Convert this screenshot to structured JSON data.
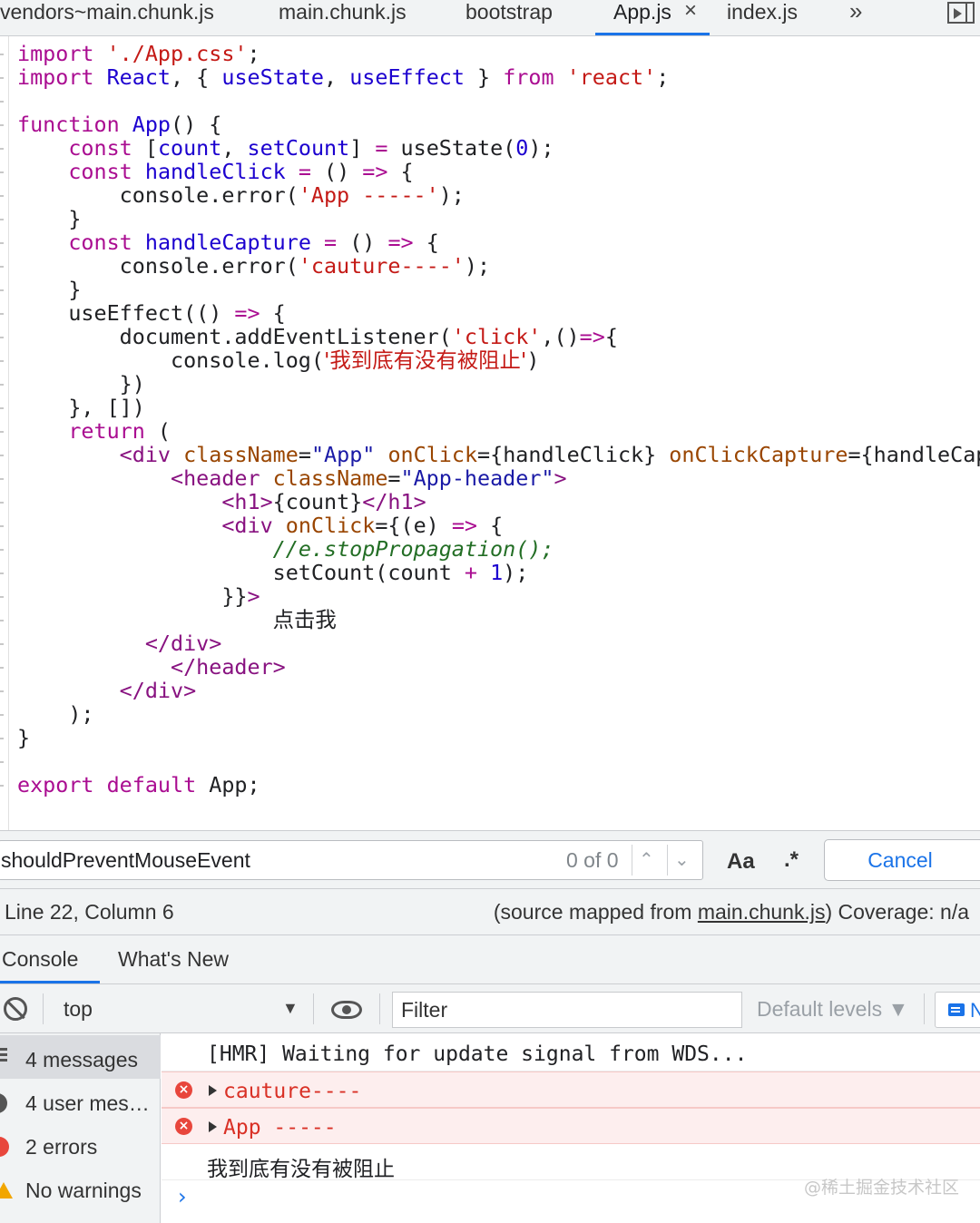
{
  "tabs": [
    {
      "label": "vendors~main.chunk.js",
      "active": false
    },
    {
      "label": "main.chunk.js",
      "active": false
    },
    {
      "label": "bootstrap",
      "active": false
    },
    {
      "label": "App.js",
      "active": true,
      "closable": true
    },
    {
      "label": "index.js",
      "active": false
    }
  ],
  "tab_overflow_symbol": "»",
  "tab_close_symbol": "×",
  "code": {
    "language": "javascript",
    "lines": [
      [
        {
          "t": "import",
          "c": "kw"
        },
        {
          "t": " "
        },
        {
          "t": "'./App.css'",
          "c": "str"
        },
        {
          "t": ";"
        }
      ],
      [
        {
          "t": "import",
          "c": "kw"
        },
        {
          "t": " "
        },
        {
          "t": "React",
          "c": "id"
        },
        {
          "t": ", { "
        },
        {
          "t": "useState",
          "c": "id"
        },
        {
          "t": ", "
        },
        {
          "t": "useEffect",
          "c": "id"
        },
        {
          "t": " } "
        },
        {
          "t": "from",
          "c": "kw"
        },
        {
          "t": " "
        },
        {
          "t": "'react'",
          "c": "str"
        },
        {
          "t": ";"
        }
      ],
      [],
      [
        {
          "t": "function",
          "c": "kw"
        },
        {
          "t": " "
        },
        {
          "t": "App",
          "c": "fn"
        },
        {
          "t": "() {"
        }
      ],
      [
        {
          "t": "    "
        },
        {
          "t": "const",
          "c": "kw"
        },
        {
          "t": " ["
        },
        {
          "t": "count",
          "c": "id"
        },
        {
          "t": ", "
        },
        {
          "t": "setCount",
          "c": "id"
        },
        {
          "t": "] "
        },
        {
          "t": "=",
          "c": "op"
        },
        {
          "t": " useState("
        },
        {
          "t": "0",
          "c": "num"
        },
        {
          "t": ");"
        }
      ],
      [
        {
          "t": "    "
        },
        {
          "t": "const",
          "c": "kw"
        },
        {
          "t": " "
        },
        {
          "t": "handleClick",
          "c": "id"
        },
        {
          "t": " "
        },
        {
          "t": "=",
          "c": "op"
        },
        {
          "t": " () "
        },
        {
          "t": "=>",
          "c": "op"
        },
        {
          "t": " {"
        }
      ],
      [
        {
          "t": "        console.error("
        },
        {
          "t": "'App -----'",
          "c": "str"
        },
        {
          "t": ");"
        }
      ],
      [
        {
          "t": "    }"
        }
      ],
      [
        {
          "t": "    "
        },
        {
          "t": "const",
          "c": "kw"
        },
        {
          "t": " "
        },
        {
          "t": "handleCapture",
          "c": "id"
        },
        {
          "t": " "
        },
        {
          "t": "=",
          "c": "op"
        },
        {
          "t": " () "
        },
        {
          "t": "=>",
          "c": "op"
        },
        {
          "t": " {"
        }
      ],
      [
        {
          "t": "        console.error("
        },
        {
          "t": "'cauture----'",
          "c": "str"
        },
        {
          "t": ");"
        }
      ],
      [
        {
          "t": "    }"
        }
      ],
      [
        {
          "t": "    useEffect(() "
        },
        {
          "t": "=>",
          "c": "op"
        },
        {
          "t": " {"
        }
      ],
      [
        {
          "t": "        document.addEventListener("
        },
        {
          "t": "'click'",
          "c": "str"
        },
        {
          "t": ",()"
        },
        {
          "t": "=>",
          "c": "op"
        },
        {
          "t": "{"
        }
      ],
      [
        {
          "t": "            console.log("
        },
        {
          "t": "'我到底有没有被阻止'",
          "c": "str cjk"
        },
        {
          "t": ")"
        }
      ],
      [
        {
          "t": "        })"
        }
      ],
      [
        {
          "t": "    }, [])"
        }
      ],
      [
        {
          "t": "    "
        },
        {
          "t": "return",
          "c": "kw"
        },
        {
          "t": " ("
        }
      ],
      [
        {
          "t": "        "
        },
        {
          "t": "<div",
          "c": "tagc"
        },
        {
          "t": " "
        },
        {
          "t": "className",
          "c": "attr"
        },
        {
          "t": "="
        },
        {
          "t": "\"App\"",
          "c": "aval"
        },
        {
          "t": " "
        },
        {
          "t": "onClick",
          "c": "attr"
        },
        {
          "t": "={handleClick} "
        },
        {
          "t": "onClickCapture",
          "c": "attr"
        },
        {
          "t": "={handleCapture}>"
        }
      ],
      [
        {
          "t": "            "
        },
        {
          "t": "<header",
          "c": "tagc"
        },
        {
          "t": " "
        },
        {
          "t": "className",
          "c": "attr"
        },
        {
          "t": "="
        },
        {
          "t": "\"App-header\"",
          "c": "aval"
        },
        {
          "t": ">",
          "c": "tagc"
        }
      ],
      [
        {
          "t": "                "
        },
        {
          "t": "<h1>",
          "c": "tagc"
        },
        {
          "t": "{count}"
        },
        {
          "t": "</h1>",
          "c": "tagc"
        }
      ],
      [
        {
          "t": "                "
        },
        {
          "t": "<div",
          "c": "tagc"
        },
        {
          "t": " "
        },
        {
          "t": "onClick",
          "c": "attr"
        },
        {
          "t": "={(e) "
        },
        {
          "t": "=>",
          "c": "op"
        },
        {
          "t": " {"
        }
      ],
      [
        {
          "t": "                    "
        },
        {
          "t": "//e.stopPropagation();",
          "c": "cmt"
        }
      ],
      [
        {
          "t": "                    setCount(count "
        },
        {
          "t": "+",
          "c": "op"
        },
        {
          "t": " "
        },
        {
          "t": "1",
          "c": "num"
        },
        {
          "t": ");"
        }
      ],
      [
        {
          "t": "                }}"
        },
        {
          "t": ">",
          "c": "tagc"
        }
      ],
      [
        {
          "t": "                    "
        },
        {
          "t": "点击我",
          "c": "cjk"
        }
      ],
      [
        {
          "t": "          "
        },
        {
          "t": "</div>",
          "c": "tagc"
        }
      ],
      [
        {
          "t": "            "
        },
        {
          "t": "</header>",
          "c": "tagc"
        }
      ],
      [
        {
          "t": "        "
        },
        {
          "t": "</div>",
          "c": "tagc"
        }
      ],
      [
        {
          "t": "    );"
        }
      ],
      [
        {
          "t": "}"
        }
      ],
      [],
      [
        {
          "t": "export",
          "c": "kw"
        },
        {
          "t": " "
        },
        {
          "t": "default",
          "c": "kw"
        },
        {
          "t": " App;"
        }
      ]
    ]
  },
  "search": {
    "query": "shouldPreventMouseEvent",
    "match_count": "0 of 0",
    "case_toggle": "Aa",
    "regex_toggle": ".*",
    "cancel_label": "Cancel"
  },
  "status": {
    "position": "Line 22, Column 6",
    "source_prefix": "(source mapped from ",
    "source_link": "main.chunk.js",
    "source_suffix": ")  Coverage: n/a"
  },
  "drawer_tabs": [
    {
      "label": "Console",
      "active": true
    },
    {
      "label": "What's New",
      "active": false
    }
  ],
  "console_toolbar": {
    "context": "top",
    "filter_placeholder": "Filter",
    "levels": "Default levels ▼",
    "sidebar_badge": "N"
  },
  "console_sidebar": [
    {
      "icon": "list-icon",
      "label": "4 messages",
      "selected": true
    },
    {
      "icon": "user-icon",
      "label": "4 user mes…",
      "selected": false
    },
    {
      "icon": "error-icon",
      "label": "2 errors",
      "selected": false
    },
    {
      "icon": "warning-icon",
      "label": "No warnings",
      "selected": false
    }
  ],
  "console_messages": [
    {
      "type": "log",
      "text": "[HMR] Waiting for update signal from WDS..."
    },
    {
      "type": "error",
      "text": "cauture----"
    },
    {
      "type": "error",
      "text": "App -----"
    },
    {
      "type": "log",
      "text": "我到底有没有被阻止"
    }
  ],
  "watermark": "@稀土掘金技术社区",
  "colors": {
    "accent": "#1a73e8",
    "error": "#d93025",
    "error_bg": "#fdeeee",
    "keyword": "#aa0d91",
    "string": "#c41a16",
    "comment": "#236e25"
  }
}
